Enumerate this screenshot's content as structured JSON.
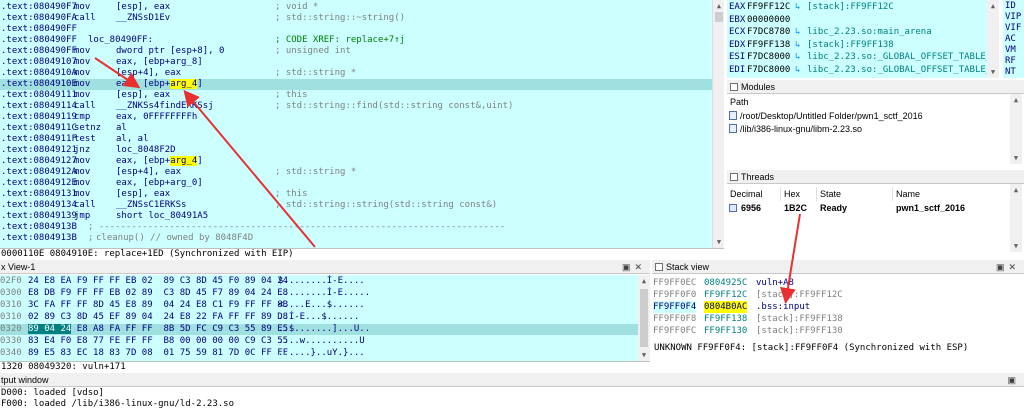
{
  "disassembly": {
    "lines": [
      {
        "addr": ".text:080490F7",
        "mn": "mov",
        "args": "[esp], eax",
        "cmt": "; void *"
      },
      {
        "addr": ".text:080490FA",
        "mn": "call",
        "args": "__ZNSsD1Ev",
        "cmt": "; std::string::~string()"
      },
      {
        "addr": ".text:080490FF",
        "mn": "",
        "args": "",
        "cmt": ""
      },
      {
        "addr": ".text:080490FF",
        "mn": "loc_80490FF:",
        "args": "",
        "cmt": "; CODE XREF: replace+7↑j"
      },
      {
        "addr": ".text:080490FF",
        "mn": "mov",
        "args": "dword ptr [esp+8], 0",
        "cmt": "; unsigned int"
      },
      {
        "addr": ".text:08049107",
        "mn": "mov",
        "args": "eax, [ebp+arg_8]",
        "cmt": ""
      },
      {
        "addr": ".text:0804910A",
        "mn": "mov",
        "args": "[esp+4], eax",
        "cmt": "; std::string *"
      },
      {
        "addr": ".text:0804910E",
        "mn": "mov",
        "args": "eax, [ebp+",
        "hl": "arg_4",
        "args2": "]",
        "cmt": ""
      },
      {
        "addr": ".text:08049111",
        "mn": "mov",
        "args": "[esp], eax",
        "cmt": "; this"
      },
      {
        "addr": ".text:08049114",
        "mn": "call",
        "args": "__ZNKSs4findERKSsj",
        "cmt": "; std::string::find(std::string const&,uint)"
      },
      {
        "addr": ".text:08049119",
        "mn": "cmp",
        "args": "eax, 0FFFFFFFFh",
        "cmt": ""
      },
      {
        "addr": ".text:0804911C",
        "mn": "setnz",
        "args": "al",
        "cmt": ""
      },
      {
        "addr": ".text:0804911F",
        "mn": "test",
        "args": "al, al",
        "cmt": ""
      },
      {
        "addr": ".text:08049121",
        "mn": "jnz",
        "args": "loc_8048F2D",
        "cmt": ""
      },
      {
        "addr": ".text:08049127",
        "mn": "mov",
        "args": "eax, [ebp+",
        "hl": "arg_4",
        "args2": "]",
        "cmt": ""
      },
      {
        "addr": ".text:0804912A",
        "mn": "mov",
        "args": "[esp+4], eax",
        "cmt": "; std::string *"
      },
      {
        "addr": ".text:0804912E",
        "mn": "mov",
        "args": "eax, [ebp+arg_0]",
        "cmt": ""
      },
      {
        "addr": ".text:08049131",
        "mn": "mov",
        "args": "[esp], eax",
        "cmt": "; this"
      },
      {
        "addr": ".text:08049134",
        "mn": "call",
        "args": "__ZNSsC1ERKSs",
        "cmt": "; std::string::string(std::string const&)"
      },
      {
        "addr": ".text:08049139",
        "mn": "jmp",
        "args": "short loc_80491A5",
        "cmt": ""
      },
      {
        "addr": ".text:0804913B",
        "mn": "; ---------------------------------------------------------------------------",
        "args": "",
        "cmt": ""
      },
      {
        "addr": ".text:0804913B",
        "mn": ";",
        "args": "cleanup() // owned by 8048F4D",
        "cmt": ""
      }
    ],
    "status": "0000110E 0804910E: replace+1ED (Synchronized with EIP)"
  },
  "registers": [
    {
      "name": "EAX",
      "val": "FF9FF12C",
      "sym": "[stack]:FF9FF12C"
    },
    {
      "name": "EBX",
      "val": "00000000",
      "sym": ""
    },
    {
      "name": "ECX",
      "val": "F7DC8780",
      "sym": "libc_2.23.so:main_arena"
    },
    {
      "name": "EDX",
      "val": "FF9FF138",
      "sym": "[stack]:FF9FF138"
    },
    {
      "name": "ESI",
      "val": "F7DC8000",
      "sym": "libc_2.23.so:_GLOBAL_OFFSET_TABLE_"
    },
    {
      "name": "EDI",
      "val": "F7DC8000",
      "sym": "libc_2.23.so:_GLOBAL_OFFSET_TABLE_"
    }
  ],
  "flags": [
    "ID",
    "VIP",
    "VIF",
    "AC",
    "VM",
    "RF",
    "NT"
  ],
  "modules": {
    "title": "Modules",
    "column": "Path",
    "items": [
      "/root/Desktop/Untitled Folder/pwn1_sctf_2016",
      "/lib/i386-linux-gnu/libm-2.23.so"
    ]
  },
  "threads": {
    "title": "Threads",
    "columns": [
      "Decimal",
      "Hex",
      "State",
      "Name"
    ],
    "rows": [
      {
        "decimal": "6956",
        "hex": "1B2C",
        "state": "Ready",
        "name": "pwn1_sctf_2016"
      }
    ]
  },
  "hexview": {
    "title": "x View-1",
    "lines": [
      {
        "addr": "02F0",
        "bytes": "24 E8 EA F9 FF FF EB 02  89 C3 8D 45 F0 89 04 24",
        "ascii": "$........Í-E...."
      },
      {
        "addr": "0300",
        "bytes": "E8 DB F9 FF FF EB 02 89  C3 8D 45 F7 89 04 24 E8",
        "ascii": ".........Í-E....."
      },
      {
        "addr": "0310",
        "bytes": "3C FA FF FF 8D 45 E8 89  04 24 E8 C1 F9 FF FF 8B",
        "ascii": "<....E...$......"
      },
      {
        "addr": "0310",
        "bytes": "02 89 C3 8D 45 EF 89 04  24 E8 22 FA FF FF 89 D8",
        "ascii": "..Í-E...$......"
      },
      {
        "addr": "0320",
        "selB": "89 04 24",
        "bytes": " E8 A8 FA FF FF  8B 5D FC C9 C3 55 89 E5",
        "ascii": "..$.......]...U.."
      },
      {
        "addr": "0330",
        "bytes": "83 E4 F0 E8 77 FE FF FF  B8 00 00 00 00 C9 C3 55",
        "ascii": "....w..........U"
      },
      {
        "addr": "0340",
        "bytes": "89 E5 83 EC 18 83 7D 08  01 75 59 81 7D 0C FF FF",
        "ascii": "......}..uY.}..."
      }
    ],
    "status": "1320 08049320: vuln+171"
  },
  "stackview": {
    "title": "Stack view",
    "lines": [
      {
        "addr": "FF9FF0EC",
        "val": "0804925C",
        "sym": "vuln+A8"
      },
      {
        "addr": "FF9FF0F0",
        "val": "FF9FF12C",
        "sym": "[stack]:FF9FF12C"
      },
      {
        "addr": "FF9FF0F4",
        "val": "0804B0AC",
        "sym": ".bss:input"
      },
      {
        "addr": "FF9FF0F8",
        "val": "FF9FF138",
        "sym": "[stack]:FF9FF138"
      },
      {
        "addr": "FF9FF0FC",
        "val": "FF9FF130",
        "sym": "[stack]:FF9FF130"
      }
    ],
    "status": "UNKNOWN FF9FF0F4: [stack]:FF9FF0F4 (Synchronized with ESP)"
  },
  "output": {
    "title": "tput window",
    "lines": [
      "D000: loaded [vdso]",
      "F000: loaded /lib/i386-linux-gnu/ld-2.23.so"
    ]
  }
}
